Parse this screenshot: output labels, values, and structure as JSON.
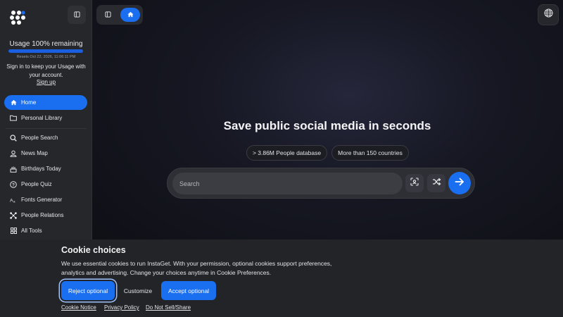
{
  "colors": {
    "accent": "#1a6ef0",
    "sidebar_bg": "#26272a",
    "page_bg": "#161722",
    "banner_bg": "#232427"
  },
  "sidebar": {
    "logo_icon": "molecule-logo-icon",
    "collapse_icon": "sidebar-panel-icon",
    "usage": {
      "title": "Usage 100% remaining",
      "remaining_fraction": 1.0,
      "reset_text": "Resets Oct 22, 2026, 11:06:11 PM",
      "message": "Sign in to keep your Usage with your account.",
      "signup_label": "Sign up"
    },
    "nav_primary": [
      {
        "label": "Home",
        "icon": "home-icon",
        "active": true
      },
      {
        "label": "Personal Library",
        "icon": "folder-icon",
        "active": false
      }
    ],
    "nav_tools": [
      {
        "label": "People Search",
        "icon": "search-icon"
      },
      {
        "label": "News Map",
        "icon": "user-map-icon"
      },
      {
        "label": "Birthdays Today",
        "icon": "cake-icon"
      },
      {
        "label": "People Quiz",
        "icon": "question-icon"
      },
      {
        "label": "Fonts Generator",
        "icon": "font-icon"
      },
      {
        "label": "People Relations",
        "icon": "network-icon"
      },
      {
        "label": "All Tools",
        "icon": "grid-icon"
      }
    ]
  },
  "topbar": {
    "tab_sidebar_icon": "sidebar-panel-icon",
    "tab_home_icon": "home-icon",
    "globe_icon": "globe-icon"
  },
  "hero": {
    "title": "Save public social media in seconds",
    "chips": [
      "> 3.86M People database",
      "More than 150 countries"
    ],
    "search_placeholder": "Search",
    "search_value": "",
    "scan_icon": "face-scan-icon",
    "shuffle_icon": "shuffle-icon",
    "submit_icon": "arrow-right-icon"
  },
  "cookie": {
    "title": "Cookie choices",
    "text": "We use essential cookies to run InstaGet. With your permission, optional cookies support preferences, analytics and advertising. Change your choices anytime in Cookie Preferences.",
    "reject_label": "Reject optional",
    "customize_label": "Customize",
    "accept_label": "Accept optional",
    "links": [
      "Cookie Notice",
      "Privacy Policy",
      "Do Not Sell/Share"
    ]
  }
}
